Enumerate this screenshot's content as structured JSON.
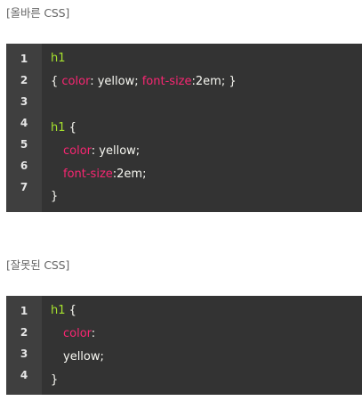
{
  "correct": {
    "caption": "[올바른 CSS]",
    "line_numbers": [
      "1",
      "2",
      "3",
      "4",
      "5",
      "6",
      "7"
    ],
    "code": {
      "l1_selector": "h1",
      "l2_open": "{ ",
      "l2_prop1": "color",
      "l2_val1": ": yellow; ",
      "l2_prop2": "font-size",
      "l2_val2": ":2em; }",
      "l4_selector": "h1",
      "l4_brace": " {",
      "l5_prop": "color",
      "l5_val": ": yellow;",
      "l6_prop": "font-size",
      "l6_val": ":2em;",
      "l7_close": "}"
    }
  },
  "wrong": {
    "caption": "[잘못된 CSS]",
    "line_numbers": [
      "1",
      "2",
      "3",
      "4"
    ],
    "code": {
      "l1_selector": "h1",
      "l1_brace": " {",
      "l2_prop": "color",
      "l2_val": ":",
      "l3_val": "yellow;",
      "l4_close": "}"
    }
  },
  "colors": {
    "code_background": "#333333",
    "gutter_background": "#3f3f3f",
    "selector": "#a6e22e",
    "property": "#f92672",
    "text": "#f8f8f2"
  }
}
